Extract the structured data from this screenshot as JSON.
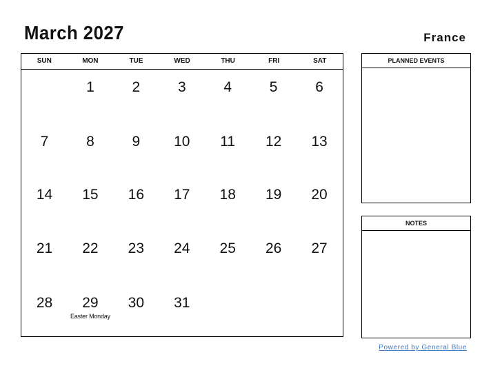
{
  "header": {
    "title": "March 2027",
    "country": "France"
  },
  "calendar": {
    "weekdays": [
      "SUN",
      "MON",
      "TUE",
      "WED",
      "THU",
      "FRI",
      "SAT"
    ],
    "weeks": [
      [
        {
          "day": ""
        },
        {
          "day": "1"
        },
        {
          "day": "2"
        },
        {
          "day": "3"
        },
        {
          "day": "4"
        },
        {
          "day": "5"
        },
        {
          "day": "6"
        }
      ],
      [
        {
          "day": "7"
        },
        {
          "day": "8"
        },
        {
          "day": "9"
        },
        {
          "day": "10"
        },
        {
          "day": "11"
        },
        {
          "day": "12"
        },
        {
          "day": "13"
        }
      ],
      [
        {
          "day": "14"
        },
        {
          "day": "15"
        },
        {
          "day": "16"
        },
        {
          "day": "17"
        },
        {
          "day": "18"
        },
        {
          "day": "19"
        },
        {
          "day": "20"
        }
      ],
      [
        {
          "day": "21"
        },
        {
          "day": "22"
        },
        {
          "day": "23"
        },
        {
          "day": "24"
        },
        {
          "day": "25"
        },
        {
          "day": "26"
        },
        {
          "day": "27"
        }
      ],
      [
        {
          "day": "28"
        },
        {
          "day": "29",
          "event": "Easter Monday"
        },
        {
          "day": "30"
        },
        {
          "day": "31"
        },
        {
          "day": ""
        },
        {
          "day": ""
        },
        {
          "day": ""
        }
      ]
    ]
  },
  "panels": {
    "planned_events": "PLANNED EVENTS",
    "notes": "NOTES"
  },
  "footer": {
    "powered_by": "Powered by General Blue"
  }
}
